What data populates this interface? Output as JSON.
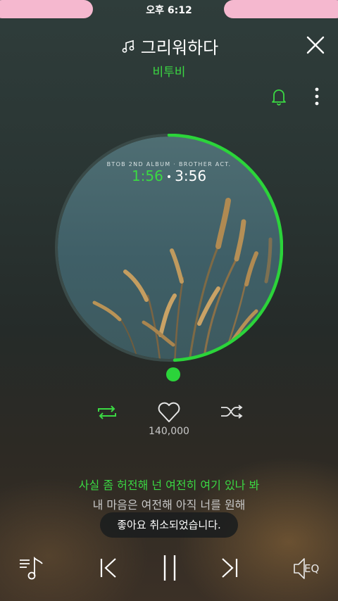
{
  "status_bar": {
    "time": "오후 6:12"
  },
  "header": {
    "title": "그리워하다",
    "artist": "비투비"
  },
  "player": {
    "album_caption": "BTOB 2ND ALBUM · BROTHER ACT.",
    "current_time": "1:56",
    "separator": "•",
    "total_time": "3:56",
    "progress_fraction": 0.492,
    "like_count": "140,000"
  },
  "lyrics": {
    "current_line": "사실 좀 허전해 넌 여전히 여기 있나 봐",
    "next_line": "내 마음은 여전해 아직 너를 원해"
  },
  "toast": {
    "message": "좋아요 취소되었습니다."
  },
  "controls": {
    "eq_label": "EQ"
  },
  "colors": {
    "accent": "#3bd843",
    "toast_bg": "#1c1e1e",
    "status_blob": "#f5b8cf"
  },
  "icons": [
    "music-note-icon",
    "close-icon",
    "bell-icon",
    "more-vertical-icon",
    "repeat-icon",
    "heart-icon",
    "shuffle-icon",
    "playlist-icon",
    "previous-icon",
    "pause-icon",
    "next-icon",
    "speaker-icon"
  ]
}
